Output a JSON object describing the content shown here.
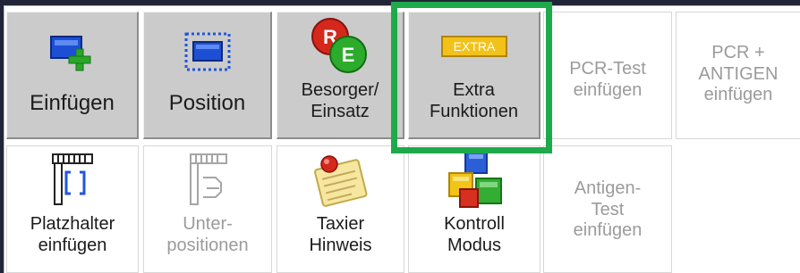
{
  "toolbar": {
    "row1": [
      {
        "id": "insert",
        "label": "Einfügen",
        "icon": "insert-rect-plus-icon"
      },
      {
        "id": "position",
        "label": "Position",
        "icon": "position-rect-icon"
      },
      {
        "id": "besorger",
        "label": "Besorger/\nEinsatz",
        "icon": "besorger-einsatz-badges-icon"
      },
      {
        "id": "extra",
        "label": "Extra\nFunktionen",
        "icon": "extra-tag-icon",
        "icon_text": "EXTRA"
      },
      {
        "id": "pcr_test",
        "label": "PCR-Test\neinfügen"
      },
      {
        "id": "pcr_antigen",
        "label": "PCR +\nANTIGEN\neinfügen"
      }
    ],
    "row2": [
      {
        "id": "platzhalter",
        "label": "Platzhalter\neinfügen",
        "icon": "placeholder-brackets-icon"
      },
      {
        "id": "unterpositionen",
        "label": "Unter-\npositionen",
        "icon": "subpositions-icon"
      },
      {
        "id": "taxier",
        "label": "Taxier\nHinweis",
        "icon": "pinned-note-icon"
      },
      {
        "id": "kontroll",
        "label": "Kontroll\nModus",
        "icon": "colored-cubes-icon"
      },
      {
        "id": "antigen",
        "label": "Antigen-\nTest\neinfügen"
      }
    ],
    "badges": {
      "r": "R",
      "e": "E"
    }
  },
  "colors": {
    "highlight": "#1eaa4a",
    "shaded_tile": "#cbcbcb",
    "background": "#222537"
  }
}
